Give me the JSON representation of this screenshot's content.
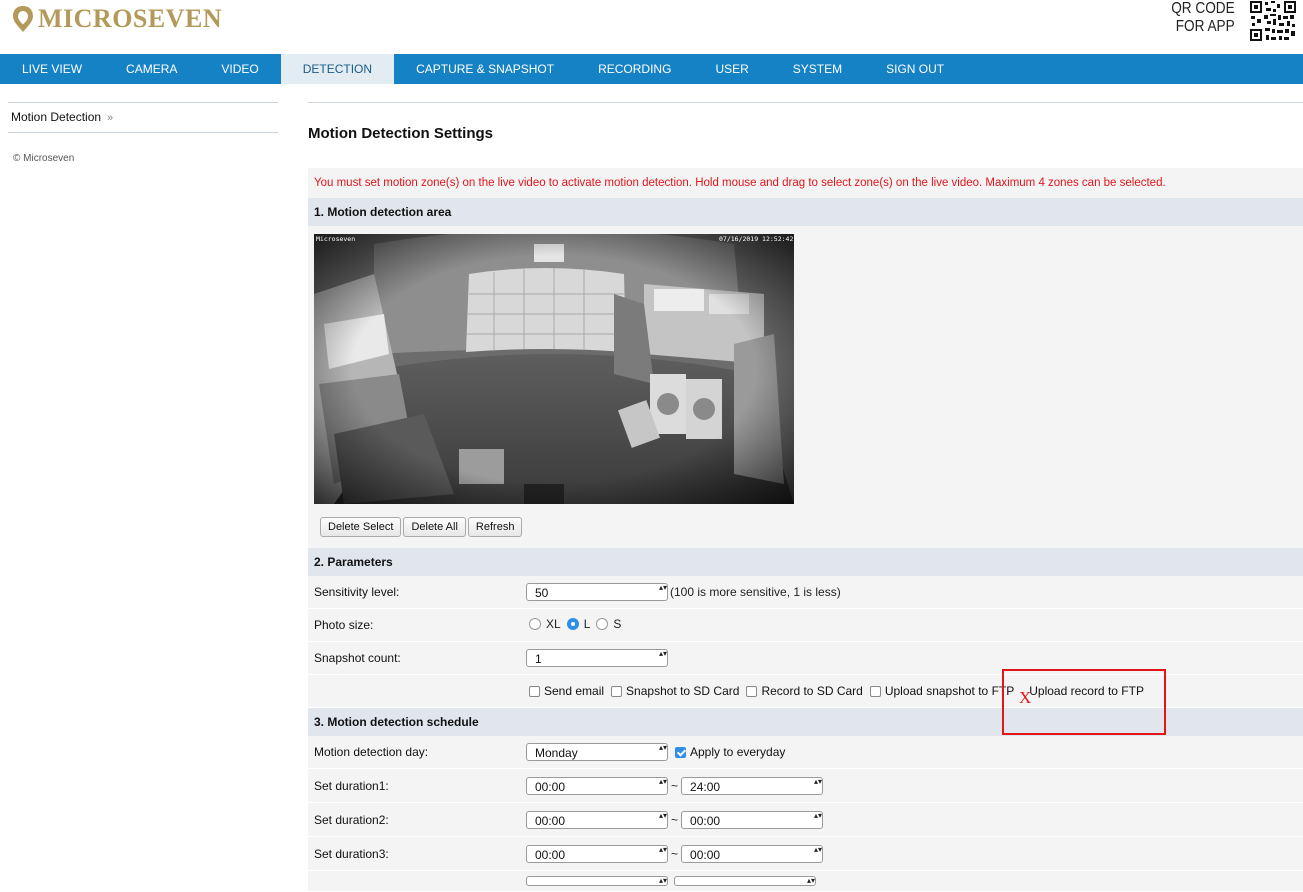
{
  "brand": {
    "logo_text": "MICROSEVEN",
    "qr_label_line1": "QR CODE",
    "qr_label_line2": "FOR APP",
    "brand_color": "#b49a5a"
  },
  "nav": {
    "accent_color": "#1582c6",
    "items": [
      {
        "label": "LIVE VIEW"
      },
      {
        "label": "CAMERA"
      },
      {
        "label": "VIDEO"
      },
      {
        "label": "DETECTION",
        "active": true
      },
      {
        "label": "CAPTURE & SNAPSHOT"
      },
      {
        "label": "RECORDING"
      },
      {
        "label": "USER"
      },
      {
        "label": "SYSTEM"
      },
      {
        "label": "SIGN OUT"
      }
    ]
  },
  "sidebar": {
    "items": [
      {
        "label": "Motion Detection",
        "suffix": "»"
      }
    ],
    "copyright": "© Microseven"
  },
  "main": {
    "title": "Motion Detection Settings",
    "warning": "You must set motion zone(s) on the live video to activate motion detection. Hold mouse and drag to select zone(s) on the live video. Maximum 4 zones can be selected.",
    "warning_color": "#e0161b",
    "area": {
      "heading": "1. Motion detection area",
      "overlay_left": "Microseven",
      "overlay_right": "07/16/2019 12:52:42",
      "buttons": {
        "delete_select": "Delete Select",
        "delete_all": "Delete All",
        "refresh": "Refresh"
      }
    },
    "parameters": {
      "heading": "2. Parameters",
      "sensitivity": {
        "label": "Sensitivity level:",
        "value": "50",
        "hint": "(100 is more sensitive, 1 is less)"
      },
      "photo_size": {
        "label": "Photo size:",
        "options": [
          "XL",
          "L",
          "S"
        ],
        "selected": "L"
      },
      "snapshot_count": {
        "label": "Snapshot count:",
        "value": "1"
      },
      "actions": {
        "send_email": "Send email",
        "snapshot_sd": "Snapshot to SD Card",
        "record_sd": "Record to SD Card",
        "upload_snapshot_ftp": "Upload snapshot to FTP",
        "upload_record_ftp": "Upload record to FTP"
      }
    },
    "schedule": {
      "heading": "3. Motion detection schedule",
      "day": {
        "label": "Motion detection day:",
        "value": "Monday",
        "apply_label": "Apply to everyday",
        "apply_checked": true
      },
      "durations": [
        {
          "label": "Set duration1:",
          "from": "00:00",
          "to": "24:00"
        },
        {
          "label": "Set duration2:",
          "from": "00:00",
          "to": "00:00"
        },
        {
          "label": "Set duration3:",
          "from": "00:00",
          "to": "00:00"
        }
      ]
    }
  },
  "annotation": {
    "mark": "X",
    "color": "#e0161b"
  }
}
